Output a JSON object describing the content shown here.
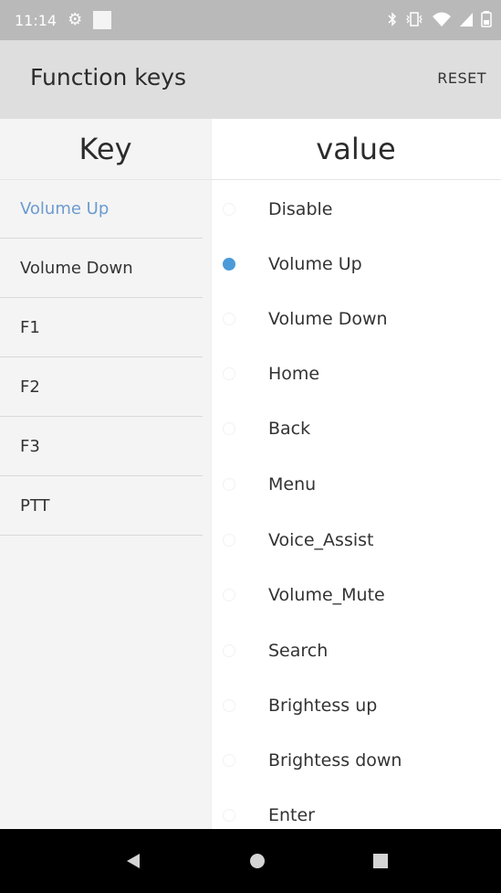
{
  "status_bar": {
    "time": "11:14",
    "icons": [
      "gear-icon",
      "notification-square-icon",
      "bluetooth-icon",
      "vibrate-icon",
      "wifi-icon",
      "signal-icon",
      "battery-icon"
    ]
  },
  "app_bar": {
    "title": "Function keys",
    "reset_label": "RESET"
  },
  "table_header": {
    "key": "Key",
    "value": "value"
  },
  "keys": [
    {
      "label": "Volume Up",
      "selected": true
    },
    {
      "label": "Volume Down",
      "selected": false
    },
    {
      "label": "F1",
      "selected": false
    },
    {
      "label": "F2",
      "selected": false
    },
    {
      "label": "F3",
      "selected": false
    },
    {
      "label": "PTT",
      "selected": false
    }
  ],
  "values": [
    {
      "label": "Disable",
      "checked": false
    },
    {
      "label": "Volume Up",
      "checked": true
    },
    {
      "label": "Volume Down",
      "checked": false
    },
    {
      "label": "Home",
      "checked": false
    },
    {
      "label": "Back",
      "checked": false
    },
    {
      "label": "Menu",
      "checked": false
    },
    {
      "label": "Voice_Assist",
      "checked": false
    },
    {
      "label": "Volume_Mute",
      "checked": false
    },
    {
      "label": "Search",
      "checked": false
    },
    {
      "label": "Brightess up",
      "checked": false
    },
    {
      "label": "Brightess down",
      "checked": false
    },
    {
      "label": "Enter",
      "checked": false
    }
  ],
  "colors": {
    "accent": "#4a9bd8",
    "selected_key_text": "#6c9bd0",
    "app_bar_bg": "#dedede",
    "status_bar_bg": "#b9b9b9",
    "nav_bar_bg": "#000000"
  },
  "nav_bar": {
    "icons": [
      "back-icon",
      "home-icon",
      "recents-icon"
    ]
  }
}
